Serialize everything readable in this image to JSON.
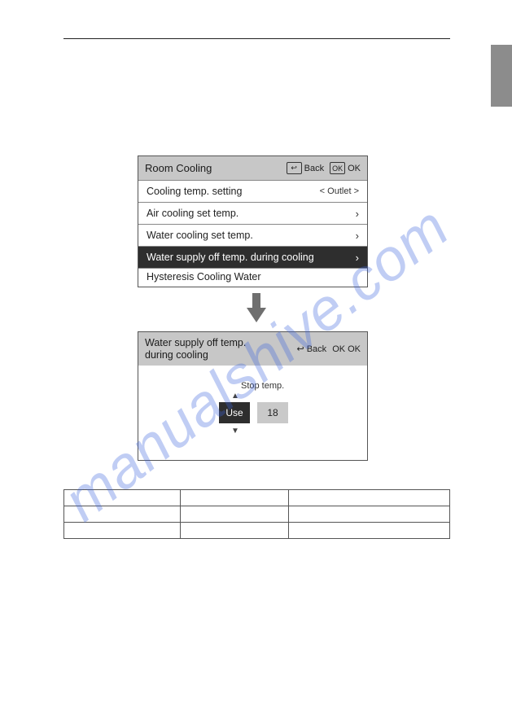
{
  "watermark": "manualshive.com",
  "screen1": {
    "title": "Room Cooling",
    "back": "Back",
    "ok": "OK",
    "rows": [
      {
        "label": "Cooling temp. setting",
        "value": "Outlet"
      },
      {
        "label": "Air cooling set temp."
      },
      {
        "label": "Water cooling set temp."
      },
      {
        "label": "Water supply off temp. during cooling",
        "selected": true
      },
      {
        "label": "Hysteresis Cooling Water"
      }
    ]
  },
  "screen2": {
    "title": "Water supply off temp.\nduring cooling",
    "back": "Back",
    "ok": "OK",
    "section_label": "Stop temp.",
    "mode": "Use",
    "value": "18"
  },
  "icons": {
    "back_glyph": "↩",
    "ok_glyph": "OK"
  }
}
